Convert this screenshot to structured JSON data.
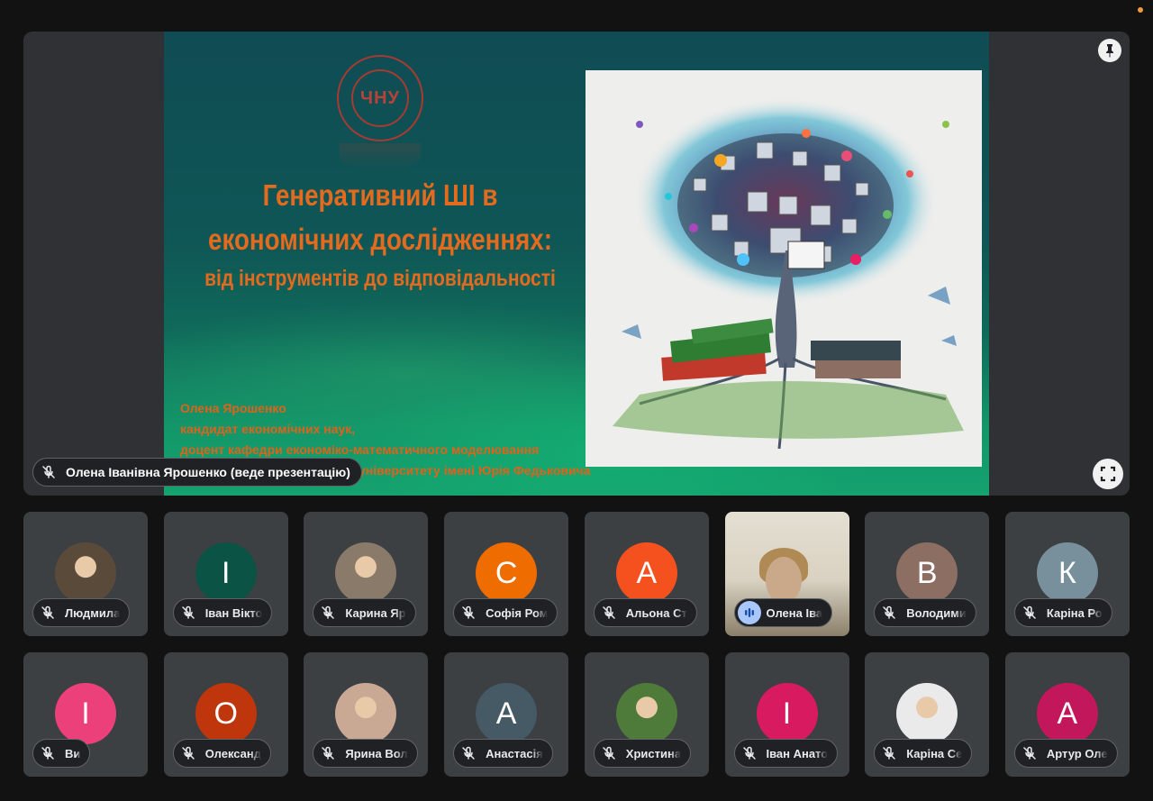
{
  "presentation": {
    "presenter_label": "Олена Іванівна Ярошенко (веде презентацію)",
    "slide": {
      "logo_text": "ЧНУ",
      "title_line1": "Генеративний ШІ в",
      "title_line2": "економічних дослідженнях:",
      "subtitle": "від інструментів до відповідальності",
      "author_name": "Олена Ярошенко",
      "author_degree": "кандидат економічних наук,",
      "author_position": "доцент кафедри економіко-математичного моделювання",
      "author_university": "університету імені Юрія Федьковича"
    },
    "pin_icon": "pin-icon",
    "fullscreen_icon": "fullscreen-icon"
  },
  "participants": [
    {
      "name": "Людмила",
      "initial": "",
      "color": "#5a4a3a",
      "photo": true,
      "muted": true
    },
    {
      "name": "Іван Вікто",
      "initial": "І",
      "color": "#0b5345",
      "photo": false,
      "muted": true
    },
    {
      "name": "Карина Яр",
      "initial": "",
      "color": "#8a7a6a",
      "photo": true,
      "muted": true
    },
    {
      "name": "Софія Ром",
      "initial": "С",
      "color": "#ef6c00",
      "photo": false,
      "muted": true
    },
    {
      "name": "Альона Ст",
      "initial": "А",
      "color": "#f4511e",
      "photo": false,
      "muted": true
    },
    {
      "name": "Олена Іва",
      "initial": "",
      "color": "#d8d2c4",
      "photo": true,
      "muted": false,
      "video": true
    },
    {
      "name": "Володими",
      "initial": "В",
      "color": "#8d6e63",
      "photo": false,
      "muted": true
    },
    {
      "name": "Каріна Ро",
      "initial": "К",
      "color": "#78909c",
      "photo": false,
      "muted": true
    },
    {
      "name": "Ви",
      "initial": "І",
      "color": "#ec407a",
      "photo": false,
      "muted": true
    },
    {
      "name": "Олександ",
      "initial": "О",
      "color": "#bf360c",
      "photo": false,
      "muted": true
    },
    {
      "name": "Ярина Вол",
      "initial": "",
      "color": "#c9a894",
      "photo": true,
      "muted": true
    },
    {
      "name": "Анастасія",
      "initial": "А",
      "color": "#455a64",
      "photo": false,
      "muted": true
    },
    {
      "name": "Христина",
      "initial": "",
      "color": "#4e7a3a",
      "photo": true,
      "muted": true
    },
    {
      "name": "Іван Анато",
      "initial": "І",
      "color": "#d81b60",
      "photo": false,
      "muted": true
    },
    {
      "name": "Каріна Се",
      "initial": "",
      "color": "#eaeaea",
      "photo": true,
      "muted": true
    },
    {
      "name": "Артур Оле",
      "initial": "А",
      "color": "#c2185b",
      "photo": false,
      "muted": true
    }
  ]
}
